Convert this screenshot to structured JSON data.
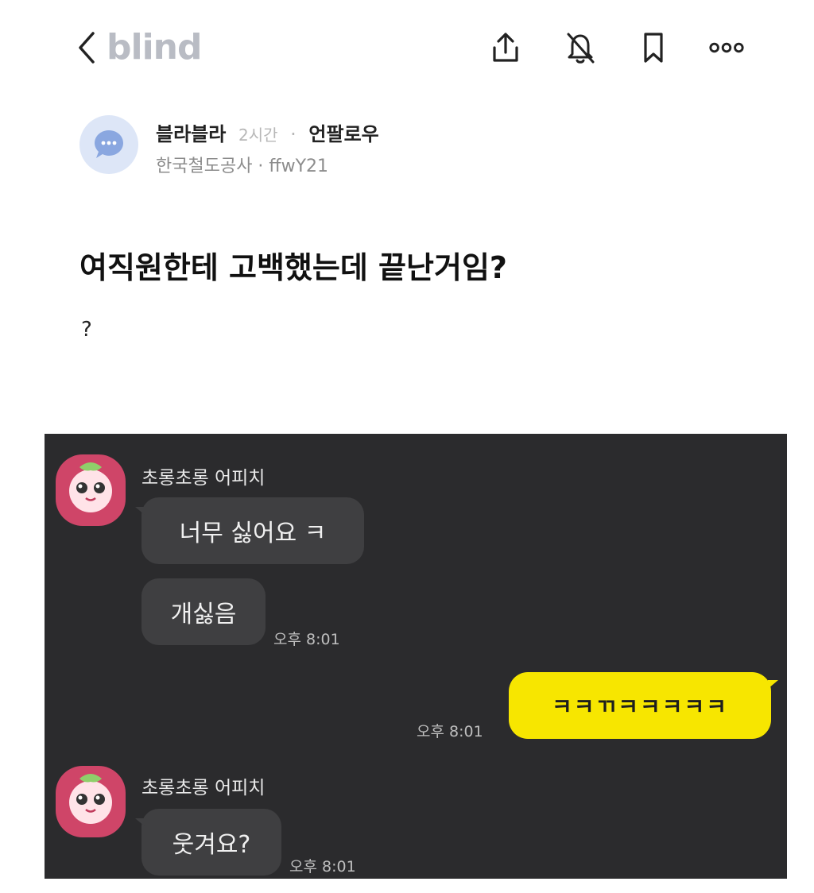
{
  "app": {
    "logo": "blind"
  },
  "header": {
    "icons": [
      "back-chevron-icon",
      "share-icon",
      "bell-off-icon",
      "bookmark-icon",
      "more-icon"
    ]
  },
  "author": {
    "name": "블라블라",
    "time": "2시간",
    "separator": "·",
    "unfollow_label": "언팔로우",
    "company_line": "한국철도공사 · ffwY21"
  },
  "post": {
    "title": "여직원한테 고백했는데 끝난거임?",
    "body": "?"
  },
  "chat": {
    "background": "#2b2b2d",
    "messages": [
      {
        "sender": "초롱초롱 어피치",
        "bubbles": [
          "너무 싫어요 ㅋ",
          "개싫음"
        ],
        "time": "오후 8:01"
      },
      {
        "sender": "me",
        "bubbles": [
          "ㅋㅋㄲㅋㅋㅋㅋㅋ"
        ],
        "time": "오후 8:01"
      },
      {
        "sender": "초롱초롱 어피치",
        "bubbles": [
          "웃겨요?"
        ],
        "time": "오후 8:01"
      }
    ]
  },
  "colors": {
    "accent_yellow": "#f7e600",
    "avatar_pink": "#cf4568",
    "logo_gray": "#b9bcc4"
  }
}
